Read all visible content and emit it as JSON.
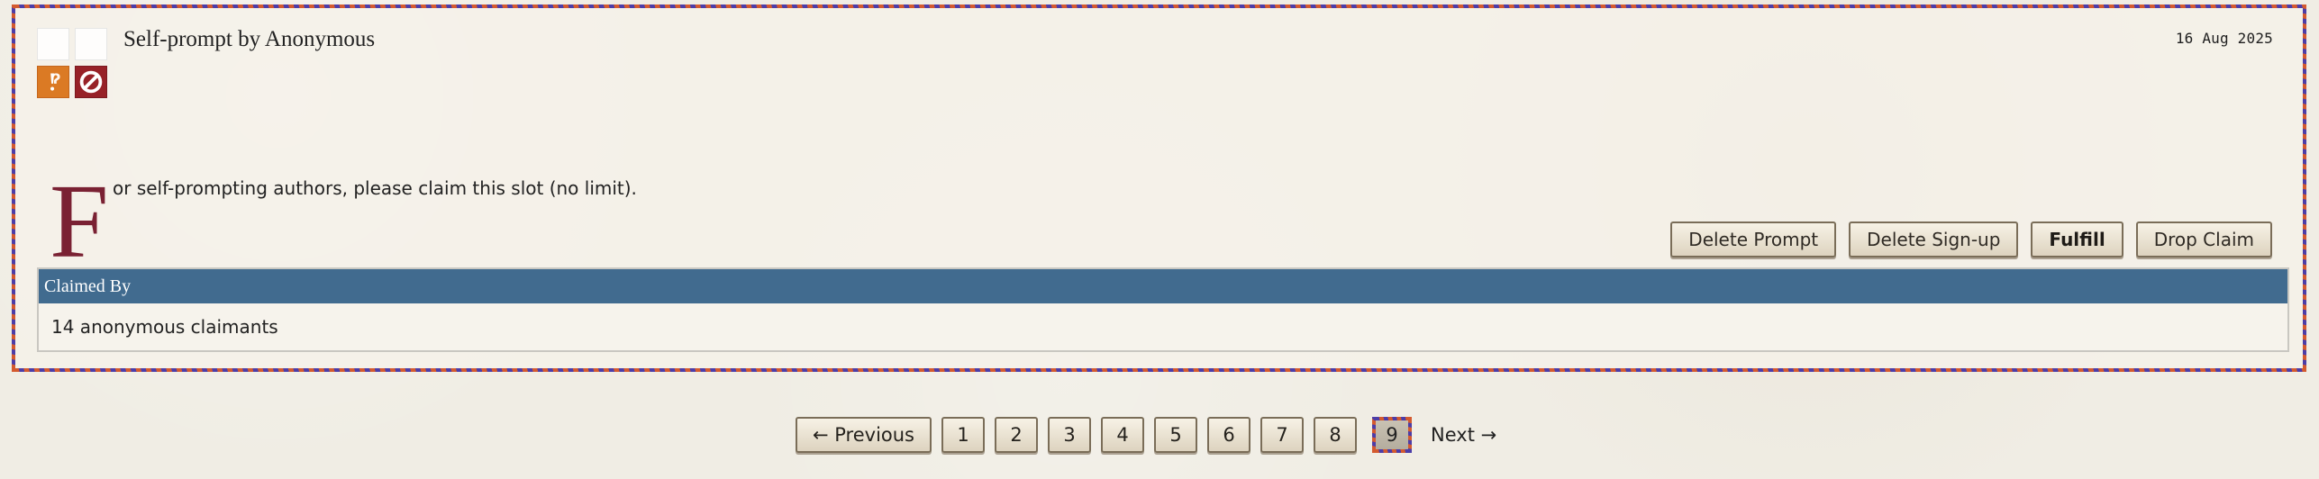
{
  "card": {
    "title": "Self-prompt by Anonymous",
    "date": "16 Aug 2025",
    "drop_cap": "F",
    "summary": "or self-prompting authors, please claim this slot (no limit).",
    "icons": {
      "top": [
        "placeholder-icon",
        "placeholder-icon"
      ],
      "bottom": [
        "warning-icon",
        "no-entry-icon"
      ]
    },
    "buttons": {
      "delete_prompt": "Delete Prompt",
      "delete_signup": "Delete Sign-up",
      "fulfill": "Fulfill",
      "drop_claim": "Drop Claim"
    },
    "claimed_by": {
      "header": "Claimed By",
      "value": "14 anonymous claimants"
    }
  },
  "pagination": {
    "previous": "← Previous",
    "pages": [
      "1",
      "2",
      "3",
      "4",
      "5",
      "6",
      "7",
      "8"
    ],
    "current": "9",
    "next": "Next →"
  },
  "colors": {
    "page_background": "#f0ede4",
    "drop_cap": "#7a2133",
    "claims_header": "#416b8f",
    "warning_icon": "#db7a24",
    "no_entry_icon": "#972127",
    "border_orange": "#d45a2f",
    "border_purple": "#4c3da8"
  }
}
